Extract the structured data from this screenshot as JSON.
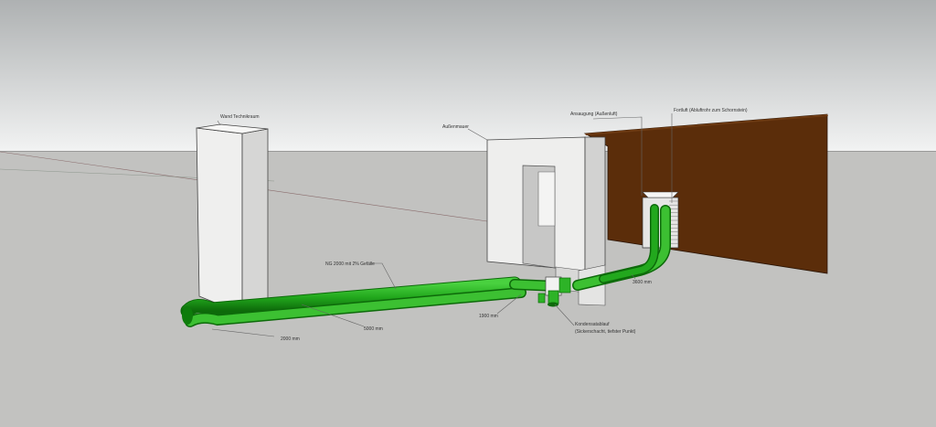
{
  "labels": {
    "wall_technical_room": "Wand Technikraum",
    "exterior_wall": "Außenmauer",
    "intake": "Ansaugung (Außenluft)",
    "exhaust": "Fortluft (Abluftrohr zum Schornstein)",
    "pipe_slope": "NG 2000 mit 2% Gefälle",
    "dim_2000": "2000 mm",
    "dim_5000": "5000 mm",
    "dim_1900": "1900 mm",
    "dim_3600": "3600 mm",
    "condensate_line1": "Kondensatablauf",
    "condensate_line2": "(Sickerschacht, tiefster Punkt)"
  },
  "colors": {
    "sky_top": "#aeb1b2",
    "sky_bottom": "#f2f3f3",
    "ground": "#c2c2c0",
    "wall_front": "#f0f0ef",
    "wall_side": "#d8d8d7",
    "pipe": "#22a81d",
    "pipe_dark": "#0d6a0a",
    "brown_wall": "#5b2d0a"
  }
}
